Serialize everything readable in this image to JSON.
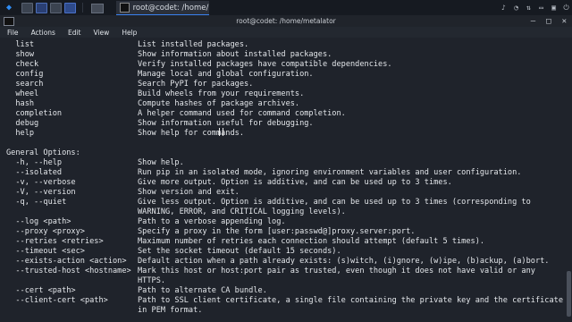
{
  "taskbar": {
    "task_title": "root@codet: /home/met...",
    "icons": [
      "kali-dragon-icon",
      "workspace-1-icon",
      "workspace-2-icon",
      "workspace-3-icon",
      "workspace-4-icon",
      "show-desktop-icon",
      "terminal-icon"
    ],
    "right_icons": [
      "speaker-icon",
      "bell-icon",
      "network-icon",
      "battery-icon",
      "lock-icon",
      "power-icon"
    ]
  },
  "window": {
    "title": "root@codet: /home/metalator",
    "controls": {
      "minimize": "–",
      "maximize": "□",
      "close": "✕"
    }
  },
  "menu": [
    "File",
    "Actions",
    "Edit",
    "View",
    "Help"
  ],
  "terminal": {
    "rows": [
      {
        "a": "  list",
        "b": "List installed packages."
      },
      {
        "a": "  show",
        "b": "Show information about installed packages."
      },
      {
        "a": "  check",
        "b": "Verify installed packages have compatible dependencies."
      },
      {
        "a": "  config",
        "b": "Manage local and global configuration."
      },
      {
        "a": "  search",
        "b": "Search PyPI for packages."
      },
      {
        "a": "  wheel",
        "b": "Build wheels from your requirements."
      },
      {
        "a": "  hash",
        "b": "Compute hashes of package archives."
      },
      {
        "a": "  completion",
        "b": "A helper command used for command completion."
      },
      {
        "a": "  debug",
        "b": "Show information useful for debugging."
      },
      {
        "a": "  help",
        "b": "Show help for commands."
      },
      {
        "a": "",
        "b": ""
      },
      {
        "full": "General Options:"
      },
      {
        "a": "  -h, --help",
        "b": "Show help."
      },
      {
        "a": "  --isolated",
        "b": "Run pip in an isolated mode, ignoring environment variables and user configuration."
      },
      {
        "a": "  -v, --verbose",
        "b": "Give more output. Option is additive, and can be used up to 3 times."
      },
      {
        "a": "  -V, --version",
        "b": "Show version and exit."
      },
      {
        "a": "  -q, --quiet",
        "b": "Give less output. Option is additive, and can be used up to 3 times (corresponding to"
      },
      {
        "a": "",
        "b": "WARNING, ERROR, and CRITICAL logging levels)."
      },
      {
        "a": "  --log <path>",
        "b": "Path to a verbose appending log."
      },
      {
        "a": "  --proxy <proxy>",
        "b": "Specify a proxy in the form [user:passwd@]proxy.server:port."
      },
      {
        "a": "  --retries <retries>",
        "b": "Maximum number of retries each connection should attempt (default 5 times)."
      },
      {
        "a": "  --timeout <sec>",
        "b": "Set the socket timeout (default 15 seconds)."
      },
      {
        "a": "  --exists-action <action>",
        "b": "Default action when a path already exists: (s)witch, (i)gnore, (w)ipe, (b)ackup, (a)bort."
      },
      {
        "a": "  --trusted-host <hostname>",
        "b": "Mark this host or host:port pair as trusted, even though it does not have valid or any"
      },
      {
        "a": "",
        "b": "HTTPS."
      },
      {
        "a": "  --cert <path>",
        "b": "Path to alternate CA bundle."
      },
      {
        "a": "  --client-cert <path>",
        "b": "Path to SSL client certificate, a single file containing the private key and the certificate"
      },
      {
        "a": "",
        "b": "in PEM format."
      }
    ]
  },
  "scrollbar": {
    "thumb_start": 0.82,
    "thumb_length": 0.16
  }
}
